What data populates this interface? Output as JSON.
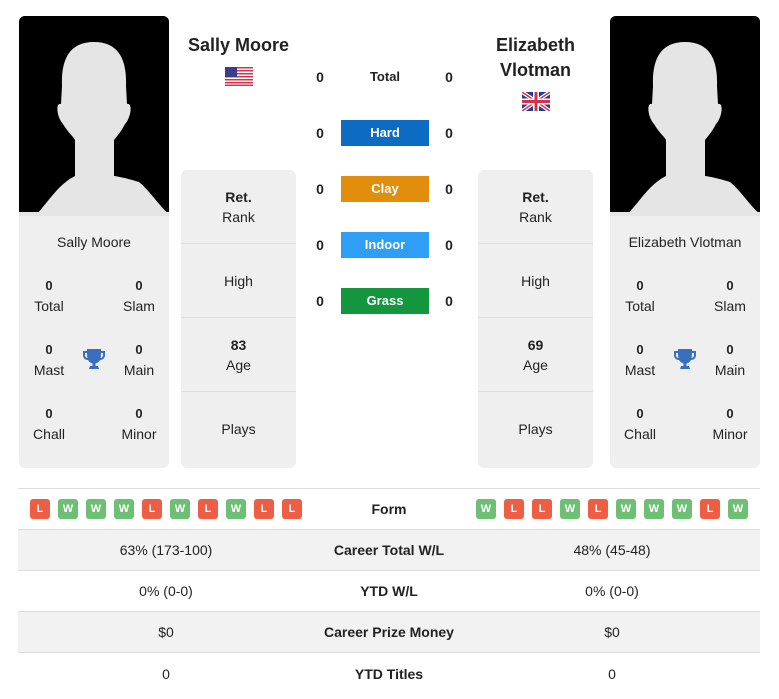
{
  "player1": {
    "name": "Sally Moore",
    "country_flag": "us-flag-icon",
    "titles": {
      "total": "0",
      "slam": "0",
      "mast": "0",
      "main": "0",
      "chall": "0",
      "minor": "0"
    },
    "labels": {
      "total": "Total",
      "slam": "Slam",
      "mast": "Mast",
      "main": "Main",
      "chall": "Chall",
      "minor": "Minor"
    },
    "info": {
      "rank_value": "Ret.",
      "rank_label": "Rank",
      "high_label": "High",
      "age_value": "83",
      "age_label": "Age",
      "plays_label": "Plays"
    }
  },
  "player2": {
    "name": "Elizabeth Vlotman",
    "country_flag": "uk-flag-icon",
    "titles": {
      "total": "0",
      "slam": "0",
      "mast": "0",
      "main": "0",
      "chall": "0",
      "minor": "0"
    },
    "labels": {
      "total": "Total",
      "slam": "Slam",
      "mast": "Mast",
      "main": "Main",
      "chall": "Chall",
      "minor": "Minor"
    },
    "info": {
      "rank_value": "Ret.",
      "rank_label": "Rank",
      "high_label": "High",
      "age_value": "69",
      "age_label": "Age",
      "plays_label": "Plays"
    }
  },
  "surfaces": [
    {
      "label": "Total",
      "p1": "0",
      "p2": "0",
      "color": ""
    },
    {
      "label": "Hard",
      "p1": "0",
      "p2": "0",
      "color": "#0d6bc4"
    },
    {
      "label": "Clay",
      "p1": "0",
      "p2": "0",
      "color": "#e08e0b"
    },
    {
      "label": "Indoor",
      "p1": "0",
      "p2": "0",
      "color": "#2e9ff5"
    },
    {
      "label": "Grass",
      "p1": "0",
      "p2": "0",
      "color": "#13963d"
    }
  ],
  "comparison": {
    "form_label": "Form",
    "p1_form": [
      "L",
      "W",
      "W",
      "W",
      "L",
      "W",
      "L",
      "W",
      "L",
      "L"
    ],
    "p2_form": [
      "W",
      "L",
      "L",
      "W",
      "L",
      "W",
      "W",
      "W",
      "L",
      "W"
    ],
    "rows": [
      {
        "label": "Career Total W/L",
        "p1": "63% (173-100)",
        "p2": "48% (45-48)"
      },
      {
        "label": "YTD W/L",
        "p1": "0% (0-0)",
        "p2": "0% (0-0)"
      },
      {
        "label": "Career Prize Money",
        "p1": "$0",
        "p2": "$0"
      },
      {
        "label": "YTD Titles",
        "p1": "0",
        "p2": "0"
      }
    ]
  }
}
